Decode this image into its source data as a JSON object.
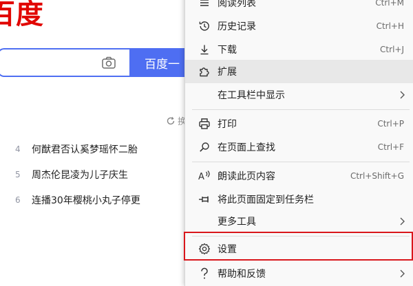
{
  "page": {
    "logo": "百度",
    "search_button": "百度一",
    "refresh_label": "换",
    "hot_list": [
      {
        "rank": "4",
        "title": "何猷君否认奚梦瑶怀二胎"
      },
      {
        "rank": "5",
        "title": "周杰伦昆凌为儿子庆生"
      },
      {
        "rank": "6",
        "title": "连播30年樱桃小丸子停更"
      }
    ]
  },
  "menu": {
    "items": [
      {
        "label": "阅读列表",
        "shortcut": "Ctrl+M",
        "icon": "reading-list-icon"
      },
      {
        "label": "历史记录",
        "shortcut": "Ctrl+H",
        "icon": "history-icon"
      },
      {
        "label": "下载",
        "shortcut": "Ctrl+J",
        "icon": "download-icon"
      },
      {
        "label": "扩展",
        "shortcut": "",
        "icon": "extensions-icon"
      },
      {
        "label": "在工具栏中显示",
        "shortcut": "",
        "icon": ""
      },
      {
        "label": "打印",
        "shortcut": "Ctrl+P",
        "icon": "print-icon"
      },
      {
        "label": "在页面上查找",
        "shortcut": "Ctrl+F",
        "icon": "find-icon"
      },
      {
        "label": "朗读此页内容",
        "shortcut": "Ctrl+Shift+G",
        "icon": "read-aloud-icon"
      },
      {
        "label": "将此页面固定到任务栏",
        "shortcut": "",
        "icon": "pin-icon"
      },
      {
        "label": "更多工具",
        "shortcut": "",
        "icon": ""
      },
      {
        "label": "设置",
        "shortcut": "",
        "icon": "gear-icon"
      },
      {
        "label": "帮助和反馈",
        "shortcut": "",
        "icon": "help-icon"
      }
    ],
    "highlight_color": "#d9161b",
    "hover_color": "#e8e8e8"
  }
}
